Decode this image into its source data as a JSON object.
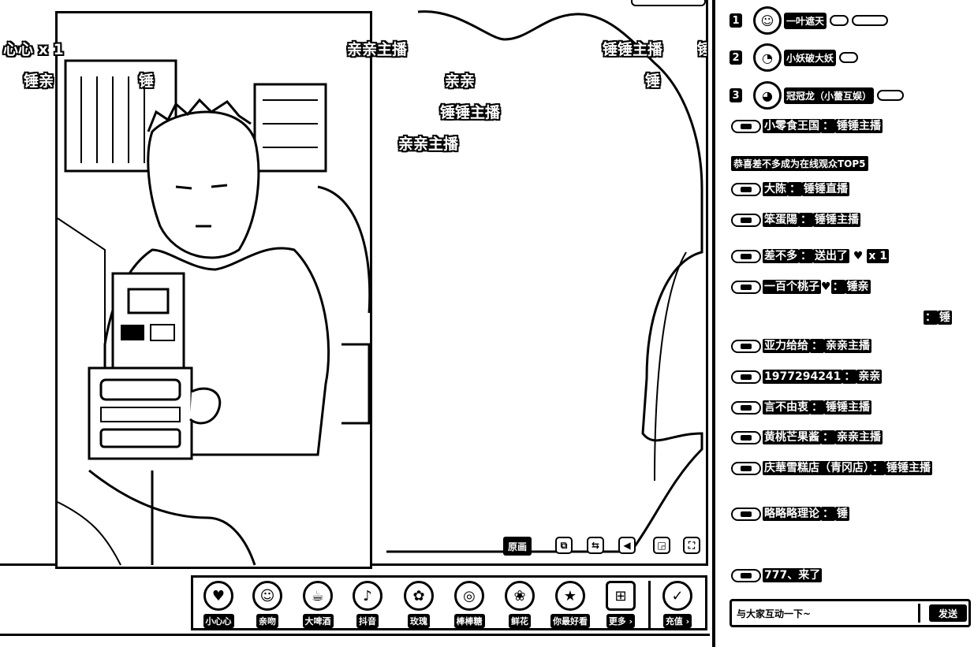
{
  "stage": {
    "danmu": [
      "心心 x 1",
      "锤亲",
      "锤",
      "亲亲主播",
      "锤锤主播",
      "亲亲",
      "锤锤主播",
      "亲亲主播",
      "锤锤主播",
      "锤",
      "锤"
    ],
    "controls": {
      "original_label": "原画",
      "icon_names": [
        "picture-in-picture-icon",
        "mirror-icon",
        "volume-icon",
        "fullscreen-window-icon",
        "fullscreen-icon"
      ]
    }
  },
  "gifts": [
    {
      "label": "小心心",
      "icon": "heart-gift-icon",
      "glyph": "♥"
    },
    {
      "label": "亲吻",
      "icon": "kiss-gift-icon",
      "glyph": "☺"
    },
    {
      "label": "大啤酒",
      "icon": "beer-gift-icon",
      "glyph": "☕"
    },
    {
      "label": "抖音",
      "icon": "douyin-gift-icon",
      "glyph": "♪"
    },
    {
      "label": "玫瑰",
      "icon": "rose-gift-icon",
      "glyph": "✿"
    },
    {
      "label": "棒棒糖",
      "icon": "lollipop-gift-icon",
      "glyph": "◎"
    },
    {
      "label": "鲜花",
      "icon": "flower-gift-icon",
      "glyph": "❀"
    },
    {
      "label": "你最好看",
      "icon": "you-look-best-gift-icon",
      "glyph": "★"
    },
    {
      "label": "更多 ›",
      "icon": "more-gifts-icon",
      "glyph": "⊞"
    }
  ],
  "recharge": {
    "label": "充值 ›",
    "icon": "recharge-icon",
    "glyph": "✓"
  },
  "ranking": [
    {
      "rank": "1",
      "name": "一叶遮天",
      "glyph": "☺"
    },
    {
      "rank": "2",
      "name": "小妖破大妖",
      "glyph": "◔"
    },
    {
      "rank": "3",
      "name": "冠冠龙（小蕾互娱）",
      "glyph": "◕"
    }
  ],
  "notice": "恭喜差不多成为在线观众TOP5",
  "chat": [
    {
      "name": "小零食王国",
      "sep": "：",
      "msg": "锤锤主播",
      "extra": ""
    },
    {
      "name": "大陈",
      "sep": "：",
      "msg": "锤锤直播",
      "extra": ""
    },
    {
      "name": "笨蛋陽",
      "sep": "：",
      "msg": "锤锤主播",
      "extra": ""
    },
    {
      "name": "差不多",
      "sep": "：",
      "msg": "送出了",
      "extra": "x 1"
    },
    {
      "name": "一百个桃子",
      "sep": "：",
      "msg": "锤亲",
      "extra": ""
    },
    {
      "name": "",
      "sep": "：",
      "msg": "锤",
      "extra": ""
    },
    {
      "name": "亚力给给",
      "sep": "：",
      "msg": "亲亲主播",
      "extra": ""
    },
    {
      "name": "1977294241",
      "sep": "：",
      "msg": "亲亲",
      "extra": ""
    },
    {
      "name": "言不由衷",
      "sep": "：",
      "msg": "锤锤主播",
      "extra": ""
    },
    {
      "name": "黄桃芒果酱",
      "sep": "：",
      "msg": "亲亲主播",
      "extra": ""
    },
    {
      "name": "庆華雪糕店（青冈店）",
      "sep": "：",
      "msg": "锤锤主播",
      "extra": ""
    },
    {
      "name": "略略略理论",
      "sep": "：",
      "msg": "锤",
      "extra": ""
    },
    {
      "name": "777、来了",
      "sep": "",
      "msg": "",
      "extra": ""
    }
  ],
  "input": {
    "placeholder": "与大家互动一下~",
    "send_label": "发送"
  }
}
